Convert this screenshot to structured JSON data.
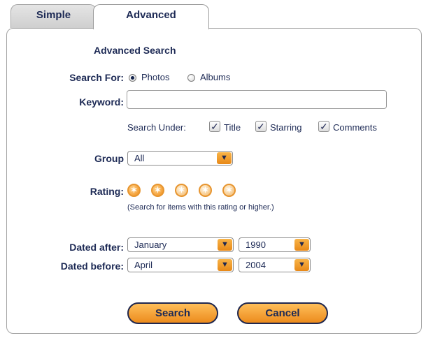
{
  "tabs": [
    {
      "label": "Simple",
      "selected": false
    },
    {
      "label": "Advanced",
      "selected": true
    }
  ],
  "title": "Advanced Search",
  "search_for": {
    "label": "Search For:",
    "options": [
      "Photos",
      "Albums"
    ],
    "selected": "Photos"
  },
  "keyword": {
    "label": "Keyword:",
    "value": ""
  },
  "search_under": {
    "label": "Search Under:",
    "items": [
      {
        "label": "Title",
        "checked": true
      },
      {
        "label": "Starring",
        "checked": true
      },
      {
        "label": "Comments",
        "checked": true
      }
    ]
  },
  "group": {
    "label": "Group",
    "value": "All"
  },
  "rating": {
    "label": "Rating:",
    "value": 2,
    "max": 5,
    "note": "(Search for items with this rating or higher.)"
  },
  "dated_after": {
    "label": "Dated after:",
    "month": "January",
    "year": "1990"
  },
  "dated_before": {
    "label": "Dated before:",
    "month": "April",
    "year": "2004"
  },
  "buttons": {
    "search": "Search",
    "cancel": "Cancel"
  }
}
